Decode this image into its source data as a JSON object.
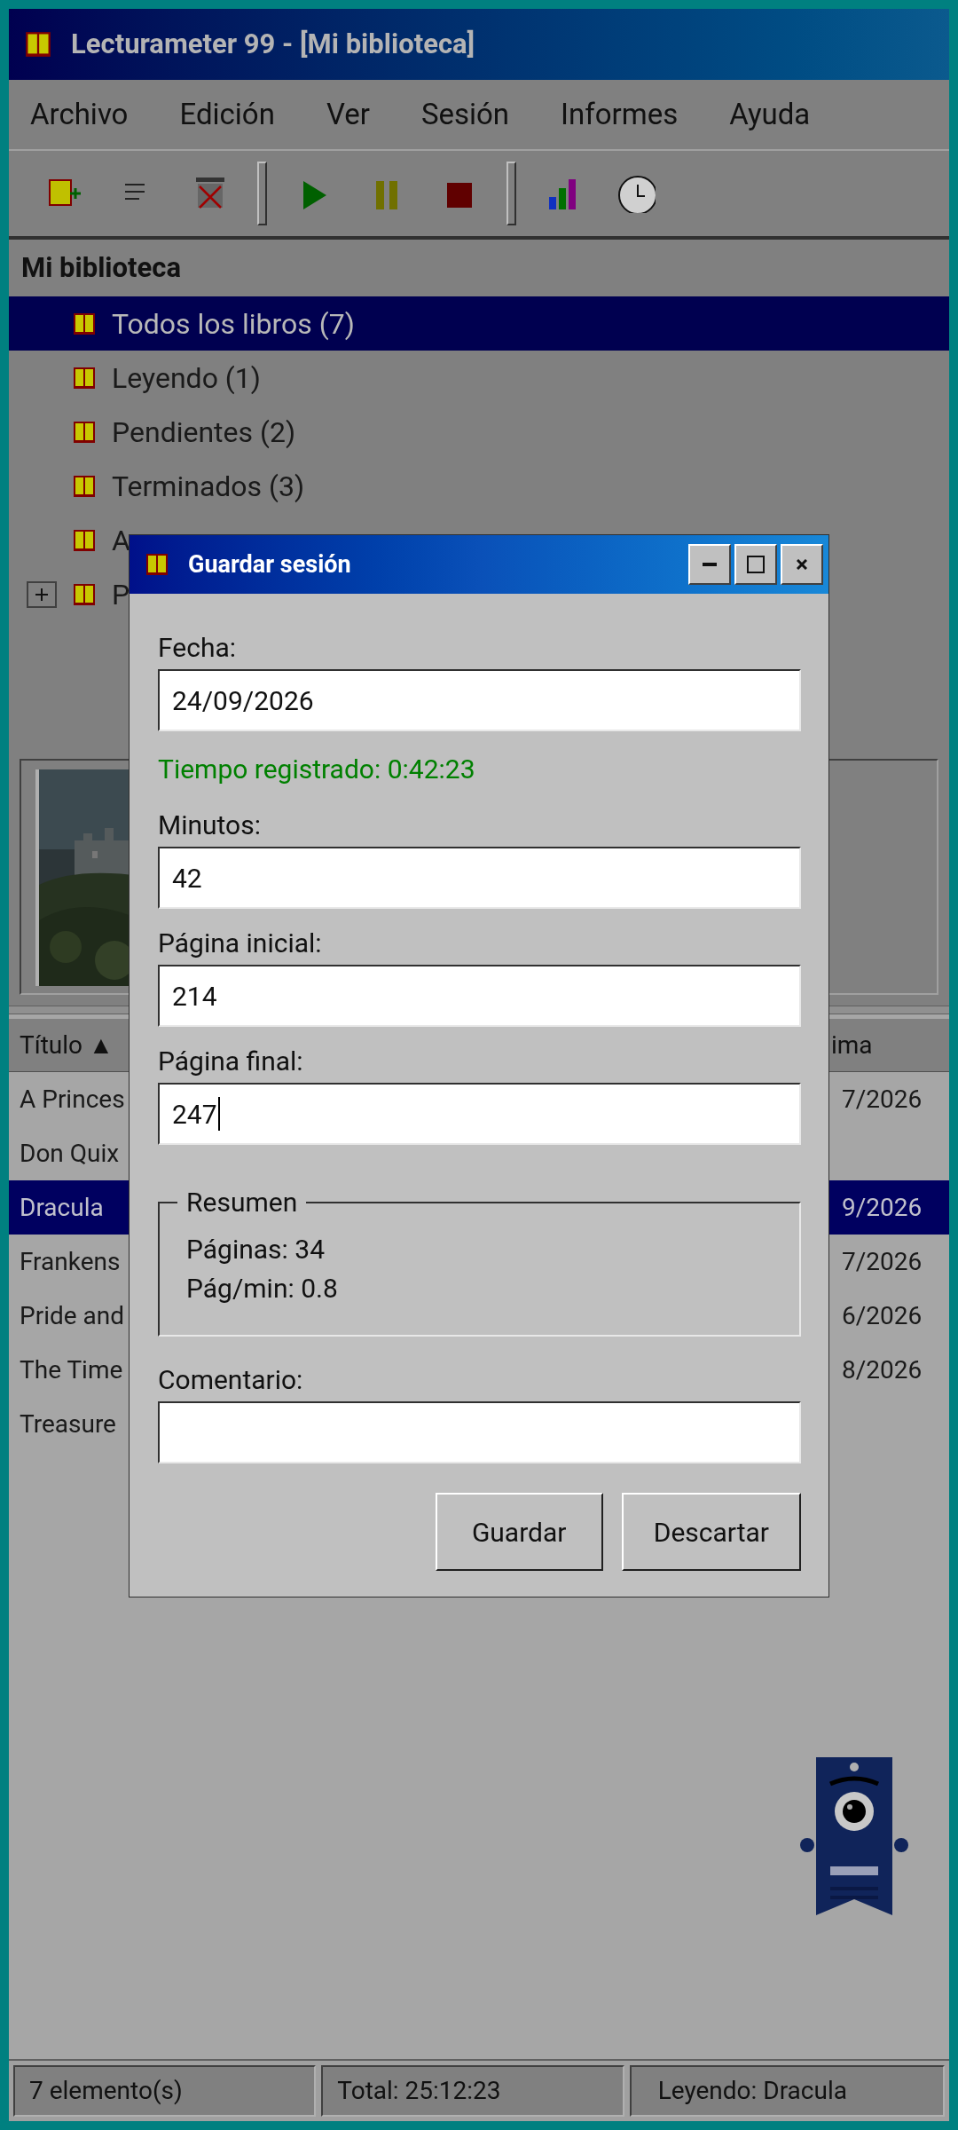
{
  "window": {
    "title": "Lecturameter 99 - [Mi biblioteca]"
  },
  "menu": [
    "Archivo",
    "Edición",
    "Ver",
    "Sesión",
    "Informes",
    "Ayuda"
  ],
  "toolbar": [
    {
      "kind": "add"
    },
    {
      "kind": "list"
    },
    {
      "kind": "delete"
    },
    {
      "kind": "separator"
    },
    {
      "kind": "play"
    },
    {
      "kind": "pause"
    },
    {
      "kind": "stop"
    },
    {
      "kind": "separator"
    },
    {
      "kind": "chart"
    },
    {
      "kind": "clock"
    }
  ],
  "tree": {
    "header": "Mi biblioteca",
    "items": [
      {
        "label": "Todos los libros (7)",
        "selected": true
      },
      {
        "label": "Leyendo (1)",
        "selected": false
      },
      {
        "label": "Pendientes (2)",
        "selected": false
      },
      {
        "label": "Terminados (3)",
        "selected": false
      },
      {
        "label": "A",
        "selected": false
      },
      {
        "label": "P",
        "selected": false,
        "expanded": false
      }
    ]
  },
  "preview": {
    "kind": "picture"
  },
  "table": {
    "columns": [
      "Título ▲",
      "ima"
    ],
    "rows": [
      {
        "cells": [
          "A Princes",
          "7/2026"
        ],
        "selected": false
      },
      {
        "cells": [
          "Don Quix"
        ],
        "selected": false
      },
      {
        "cells": [
          "Dracula",
          "9/2026"
        ],
        "selected": true
      },
      {
        "cells": [
          "Frankens",
          "7/2026"
        ],
        "selected": false
      },
      {
        "cells": [
          "Pride and",
          "6/2026"
        ],
        "selected": false
      },
      {
        "cells": [
          "The Time",
          "8/2026"
        ],
        "selected": false
      },
      {
        "cells": [
          "Treasure"
        ],
        "selected": false
      }
    ]
  },
  "dialog": {
    "title": "Guardar sesión",
    "fields": [
      {
        "label": "Fecha:",
        "value": "24/09/2026",
        "focused": false
      },
      {
        "kind": "note",
        "text": "Tiempo registrado: 0:42:23"
      },
      {
        "label": "Minutos:",
        "value": "42",
        "focused": false
      },
      {
        "label": "Página inicial:",
        "value": "214",
        "focused": false
      },
      {
        "label": "Página final:",
        "value": "247",
        "focused": true
      }
    ],
    "summary": {
      "title": "Resumen",
      "lines": [
        "Páginas: 34",
        "Pág/min: 0.8"
      ]
    },
    "comment": {
      "label": "Comentario:"
    },
    "buttons": [
      "Guardar",
      "Descartar"
    ]
  },
  "status_bar": [
    "7 elemento(s)",
    "Total: 25:12:23",
    "Leyendo: Dracula"
  ]
}
